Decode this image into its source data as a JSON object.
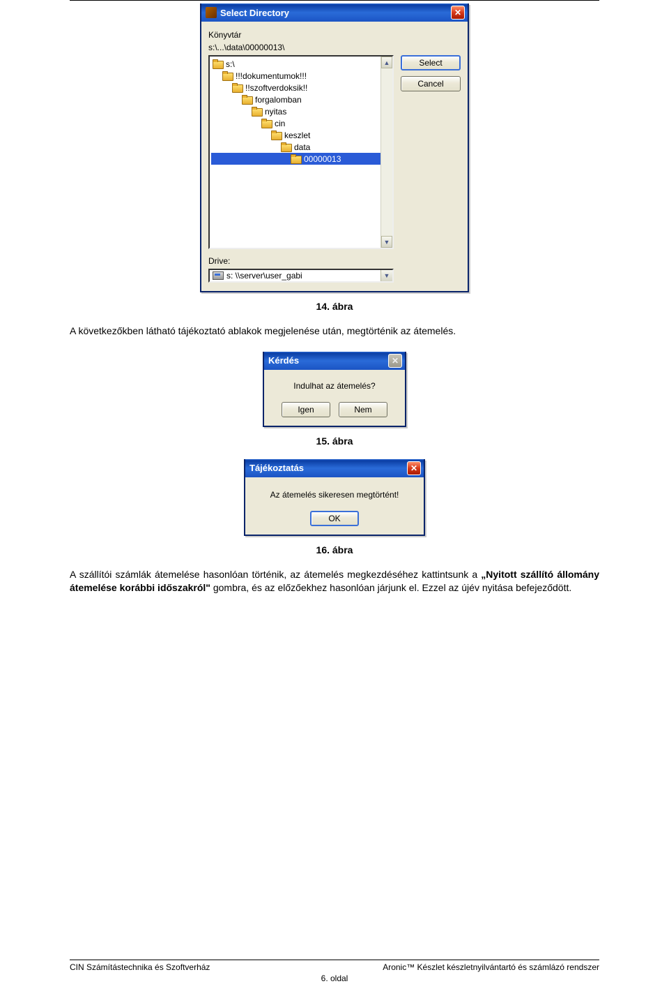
{
  "dialog_select": {
    "title": "Select Directory",
    "label_dir": "Könyvtár",
    "path": "s:\\...\\data\\00000013\\",
    "tree": [
      {
        "label": "s:\\",
        "indent": 0
      },
      {
        "label": "!!!dokumentumok!!!",
        "indent": 1
      },
      {
        "label": "!!szoftverdoksik!!",
        "indent": 2
      },
      {
        "label": "forgalomban",
        "indent": 3
      },
      {
        "label": "nyitas",
        "indent": 4
      },
      {
        "label": "cin",
        "indent": 5
      },
      {
        "label": "keszlet",
        "indent": 6
      },
      {
        "label": "data",
        "indent": 7
      },
      {
        "label": "00000013",
        "indent": 8,
        "selected": true
      }
    ],
    "btn_select": "Select",
    "btn_cancel": "Cancel",
    "label_drive": "Drive:",
    "drive_value": "s: \\\\server\\user_gabi"
  },
  "caption1": "14. ábra",
  "para1": "A következőkben látható tájékoztató ablakok megjelenése után, megtörténik az átemelés.",
  "dialog_question": {
    "title": "Kérdés",
    "text": "Indulhat az átemelés?",
    "btn_yes": "Igen",
    "btn_no": "Nem"
  },
  "caption2": "15. ábra",
  "dialog_info": {
    "title": "Tájékoztatás",
    "text": "Az átemelés sikeresen megtörtént!",
    "btn_ok": "OK"
  },
  "caption3": "16. ábra",
  "para2_pre": "A szállítói számlák átemelése hasonlóan történik, az átemelés megkezdéséhez kattintsunk a ",
  "para2_bold": "„Nyitott szállító állomány átemelése korábbi időszakról\"",
  "para2_post": " gombra, és az előzőekhez hasonlóan járjunk el. Ezzel az újév nyitása befejeződött.",
  "footer": {
    "left": "CIN Számítástechnika és Szoftverház",
    "right": "Aronic™ Készlet készletnyilvántartó és számlázó rendszer",
    "page": "6. oldal"
  }
}
